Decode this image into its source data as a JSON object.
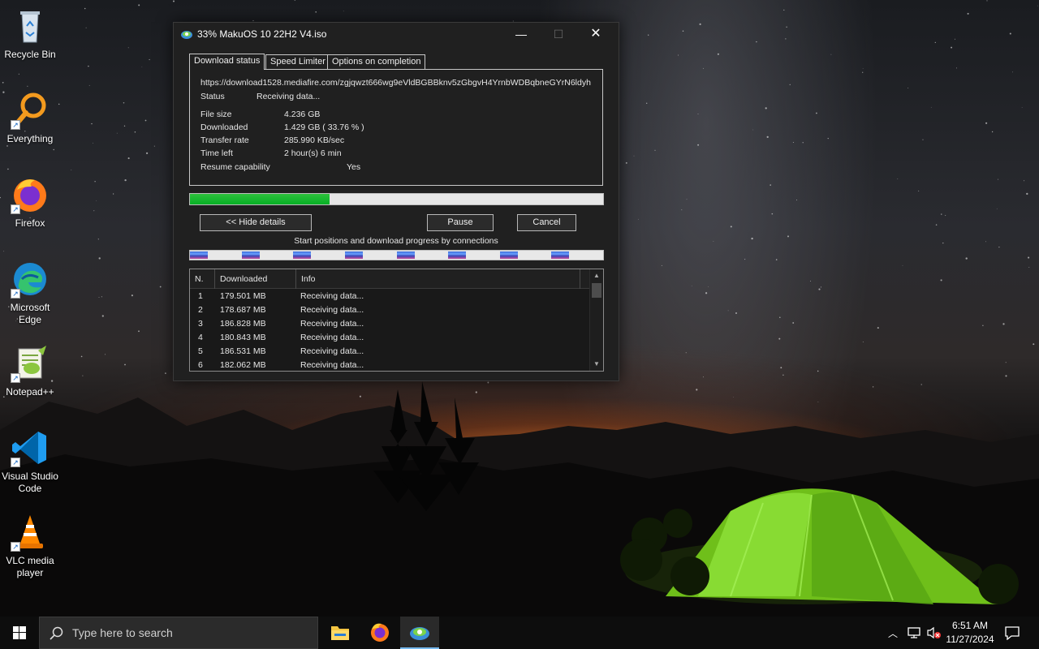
{
  "desktop": {
    "icons": [
      {
        "label": "Recycle Bin",
        "icon": "recycle-bin-icon"
      },
      {
        "label": "Everything",
        "icon": "everything-search-icon"
      },
      {
        "label": "Firefox",
        "icon": "firefox-icon"
      },
      {
        "label": "Microsoft Edge",
        "icon": "edge-icon"
      },
      {
        "label": "Notepad++",
        "icon": "notepadpp-icon"
      },
      {
        "label": "Visual Studio Code",
        "icon": "vscode-icon"
      },
      {
        "label": "VLC media player",
        "icon": "vlc-icon"
      }
    ]
  },
  "window": {
    "title": "33% MakuOS 10 22H2 V4.iso",
    "min_glyph": "—",
    "max_glyph": "☐",
    "close_glyph": "✕",
    "tabs": [
      {
        "label": "Download status"
      },
      {
        "label": "Speed Limiter"
      },
      {
        "label": "Options on completion"
      }
    ],
    "status": {
      "url": "https://download1528.mediafire.com/zgjqwzt666wg9eVldBGBBknv5zGbgvH4YrnbWDBqbneGYrN6ldyh",
      "status_label": "Status",
      "status_value": "Receiving data...",
      "filesize_label": "File size",
      "filesize_value": "4.236  GB",
      "downloaded_label": "Downloaded",
      "downloaded_value": "1.429  GB  ( 33.76 % )",
      "rate_label": "Transfer rate",
      "rate_value": "285.990  KB/sec",
      "timeleft_label": "Time left",
      "timeleft_value": "2 hour(s) 6 min",
      "resume_label": "Resume capability",
      "resume_value": "Yes"
    },
    "progress_fraction": 0.3376,
    "buttons": {
      "hide_details": "<< Hide details",
      "pause": "Pause",
      "cancel": "Cancel"
    },
    "connections_caption": "Start positions and download progress by connections",
    "connections_count": 8,
    "list": {
      "columns": [
        "N.",
        "Downloaded",
        "Info"
      ],
      "rows": [
        {
          "n": "1",
          "downloaded": "179.501  MB",
          "info": "Receiving data..."
        },
        {
          "n": "2",
          "downloaded": "178.687  MB",
          "info": "Receiving data..."
        },
        {
          "n": "3",
          "downloaded": "186.828  MB",
          "info": "Receiving data..."
        },
        {
          "n": "4",
          "downloaded": "180.843  MB",
          "info": "Receiving data..."
        },
        {
          "n": "5",
          "downloaded": "186.531  MB",
          "info": "Receiving data..."
        },
        {
          "n": "6",
          "downloaded": "182.062  MB",
          "info": "Receiving data..."
        }
      ]
    }
  },
  "taskbar": {
    "search_placeholder": "Type here to search",
    "time": "6:51 AM",
    "date": "11/27/2024",
    "apps": [
      "file-explorer-icon",
      "firefox-icon",
      "idm-icon"
    ]
  },
  "colors": {
    "progress_green": "#06b025",
    "taskbar_accent": "#76b9ed"
  }
}
